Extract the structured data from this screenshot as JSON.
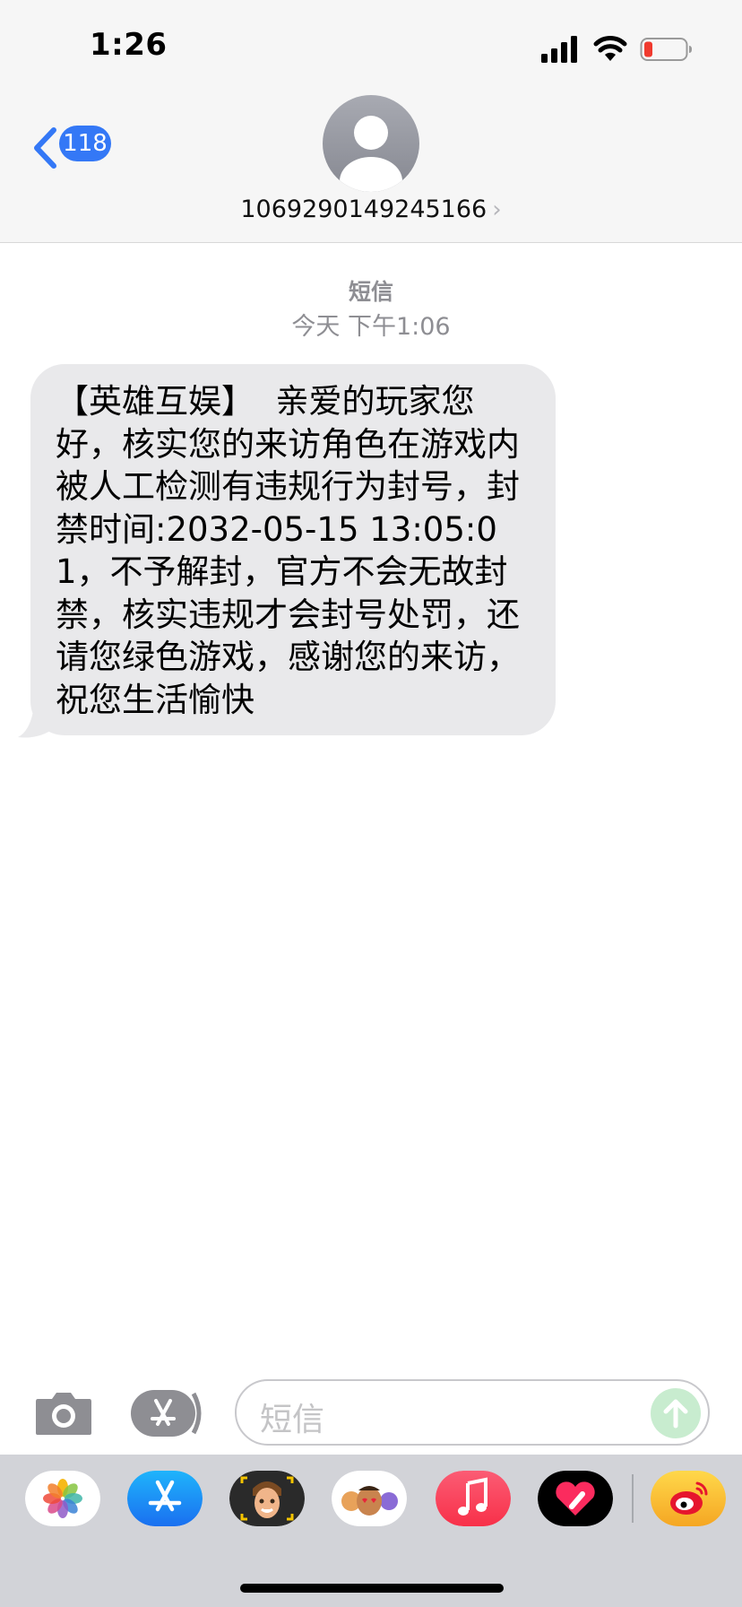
{
  "status": {
    "time": "1:26"
  },
  "nav": {
    "back_count": "118",
    "sender": "1069290149245166",
    "sender_chev": "›"
  },
  "thread": {
    "service": "短信",
    "timestamp": "今天 下午1:06"
  },
  "message": {
    "text": "【英雄互娱】  亲爱的玩家您好，核实您的来访角色在游戏内被人工检测有违规行为封号，封禁时间:2032-05-15 13:05:01，不予解封，官方不会无故封禁，核实违规才会封号处罚，还请您绿色游戏，感谢您的来访，祝您生活愉快"
  },
  "composer": {
    "placeholder": "短信"
  },
  "colors": {
    "accent": "#3478f6",
    "bubble": "#e9e9eb",
    "send_disabled": "#c8eccf"
  },
  "app_drawer": {
    "icons": [
      "photos-icon",
      "app-store-icon",
      "memoji-icon",
      "animoji-stickers-icon",
      "music-icon",
      "digital-touch-icon",
      "weibo-icon"
    ]
  }
}
